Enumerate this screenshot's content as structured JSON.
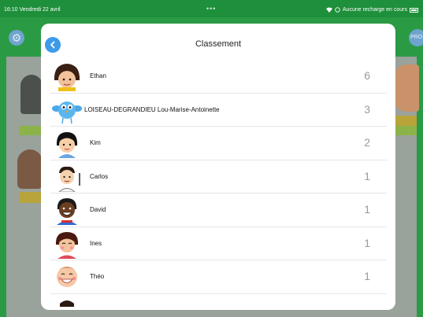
{
  "status_bar": {
    "time_date": "16:10  Vendredi 22 avril",
    "dots": "•••",
    "right_text": "Aucune recharge en cours"
  },
  "background": {
    "pro_label": "PRO"
  },
  "modal": {
    "title": "Classement",
    "rows": [
      {
        "name": "Ethan",
        "score": "6",
        "avatar": "ethan-avatar"
      },
      {
        "name": "LOISEAU-DEGRANDIEU Lou-Marise-Antoinette",
        "score": "3",
        "avatar": "bird-avatar"
      },
      {
        "name": "Kim",
        "score": "2",
        "avatar": "kim-avatar"
      },
      {
        "name": "Carlos",
        "score": "1",
        "avatar": "carlos-avatar"
      },
      {
        "name": "David",
        "score": "1",
        "avatar": "david-avatar"
      },
      {
        "name": "Ines",
        "score": "1",
        "avatar": "ines-avatar"
      },
      {
        "name": "Théo",
        "score": "1",
        "avatar": "theo-avatar"
      }
    ]
  },
  "colors": {
    "app_green": "#1e8f3a",
    "accent_blue": "#3d9be9",
    "score_gray": "#9a9a9a"
  }
}
